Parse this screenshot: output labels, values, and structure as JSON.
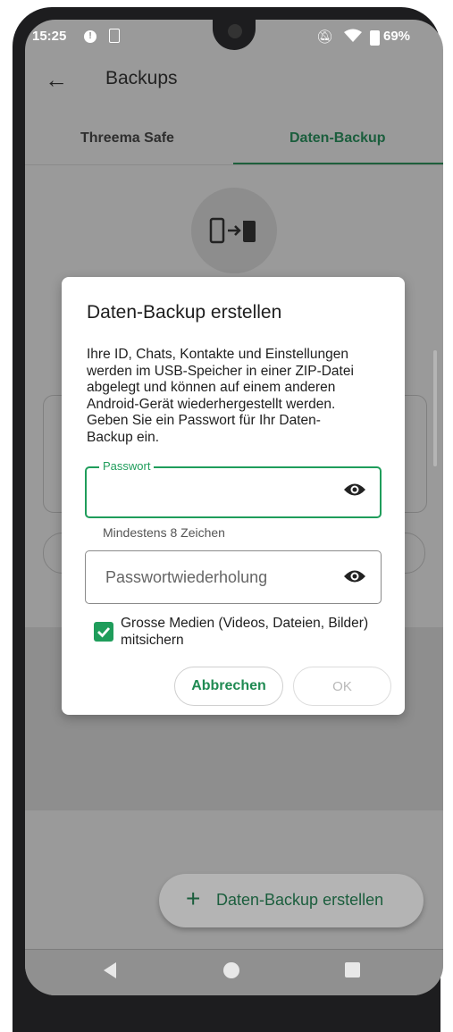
{
  "status_bar": {
    "time": "15:25",
    "battery": "69%",
    "icons": [
      "alert-icon",
      "sim-icon",
      "mute-icon",
      "wifi-icon",
      "battery-icon"
    ]
  },
  "app_bar": {
    "title": "Backups",
    "back_icon": "arrow-left-icon"
  },
  "tabs": [
    {
      "label": "Threema Safe",
      "selected": false
    },
    {
      "label": "Daten-Backup",
      "selected": true
    }
  ],
  "dialog": {
    "title": "Daten-Backup erstellen",
    "message": "Ihre ID, Chats, Kontakte und Einstellungen werden im USB-Speicher in einer ZIP-Datei abgelegt und können auf einem anderen Android-Gerät wiederhergestellt werden. Geben Sie ein Passwort für Ihr Daten-Backup ein.",
    "password_field": {
      "label": "Passwort",
      "value": "",
      "helper": "Mindestens 8 Zeichen"
    },
    "repeat_field": {
      "placeholder": "Passwortwiederholung",
      "value": ""
    },
    "checkbox": {
      "label": "Grosse Medien (Videos, Dateien, Bilder) mitsichern",
      "checked": true
    },
    "cancel_label": "Abbrechen",
    "ok_label": "OK"
  },
  "fab": {
    "label": "Daten-Backup erstellen",
    "icon": "plus-icon"
  },
  "colors": {
    "accent": "#1f9d5b",
    "accent_dark": "#1b5e3d",
    "scrim": "#9a9a9a"
  }
}
